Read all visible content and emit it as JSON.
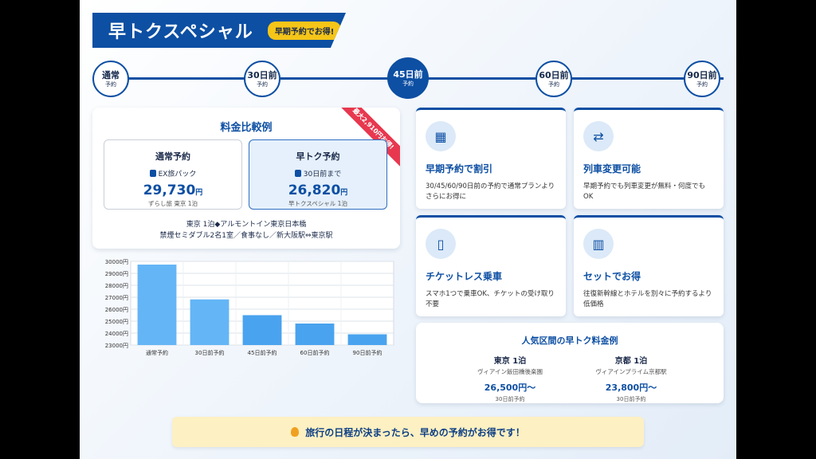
{
  "header": {
    "title": "早トクスペシャル",
    "badge": "早期予約でお得!"
  },
  "timeline": [
    {
      "main": "通常",
      "sub": "予約",
      "active": false
    },
    {
      "main": "30日前",
      "sub": "予約",
      "active": false
    },
    {
      "main": "45日前",
      "sub": "予約",
      "active": true
    },
    {
      "main": "60日前",
      "sub": "予約",
      "active": false
    },
    {
      "main": "90日前",
      "sub": "予約",
      "active": false
    }
  ],
  "comparison": {
    "title": "料金比較例",
    "ribbon": "最大2,910円お得!",
    "normal": {
      "label": "通常予約",
      "cond": "EX旅パック",
      "price": "29,730",
      "unit": "円",
      "note": "ずらし旅 東京 1泊"
    },
    "early": {
      "label": "早トク予約",
      "cond": "30日前まで",
      "price": "26,820",
      "unit": "円",
      "note": "早トクスペシャル 1泊"
    },
    "desc_line1": "東京 1泊◆アルモントイン東京日本橋",
    "desc_line2": "禁煙セミダブル2名1室／食事なし／新大阪駅⇔東京駅"
  },
  "chart_data": {
    "type": "bar",
    "categories": [
      "通常予約",
      "30日前予約",
      "45日前予約",
      "60日前予約",
      "90日前予約"
    ],
    "values": [
      29730,
      26820,
      25500,
      24800,
      23900
    ],
    "ylim": [
      23000,
      30000
    ],
    "yticks": [
      "23000円",
      "24000円",
      "25000円",
      "26000円",
      "27000円",
      "28000円",
      "29000円",
      "30000円"
    ],
    "grid": true,
    "colors": [
      "#64b5f6",
      "#64b5f6",
      "#4aa3ee",
      "#4aa3ee",
      "#4aa3ee"
    ]
  },
  "features": [
    {
      "icon": "calendar-icon",
      "glyph": "▦",
      "title": "早期予約で割引",
      "desc": "30/45/60/90日前の予約で通常プランよりさらにお得に"
    },
    {
      "icon": "swap-icon",
      "glyph": "⇄",
      "title": "列車変更可能",
      "desc": "早期予約でも列車変更が無料・何度でもOK"
    },
    {
      "icon": "smartphone-icon",
      "glyph": "▯",
      "title": "チケットレス乗車",
      "desc": "スマホ1つで乗車OK、チケットの受け取り不要"
    },
    {
      "icon": "building-icon",
      "glyph": "▥",
      "title": "セットでお得",
      "desc": "往復新幹線とホテルを別々に予約するより低価格"
    }
  ],
  "routes": {
    "title": "人気区間の早トク料金例",
    "items": [
      {
        "name": "東京 1泊",
        "hotel": "ヴィアイン飯田橋後楽園",
        "price": "26,500円〜",
        "note": "30日前予約"
      },
      {
        "name": "京都 1泊",
        "hotel": "ヴィアインプライム京都駅",
        "price": "23,800円〜",
        "note": "30日前予約"
      }
    ]
  },
  "tip": "旅行の日程が決まったら、早めの予約がお得です！"
}
